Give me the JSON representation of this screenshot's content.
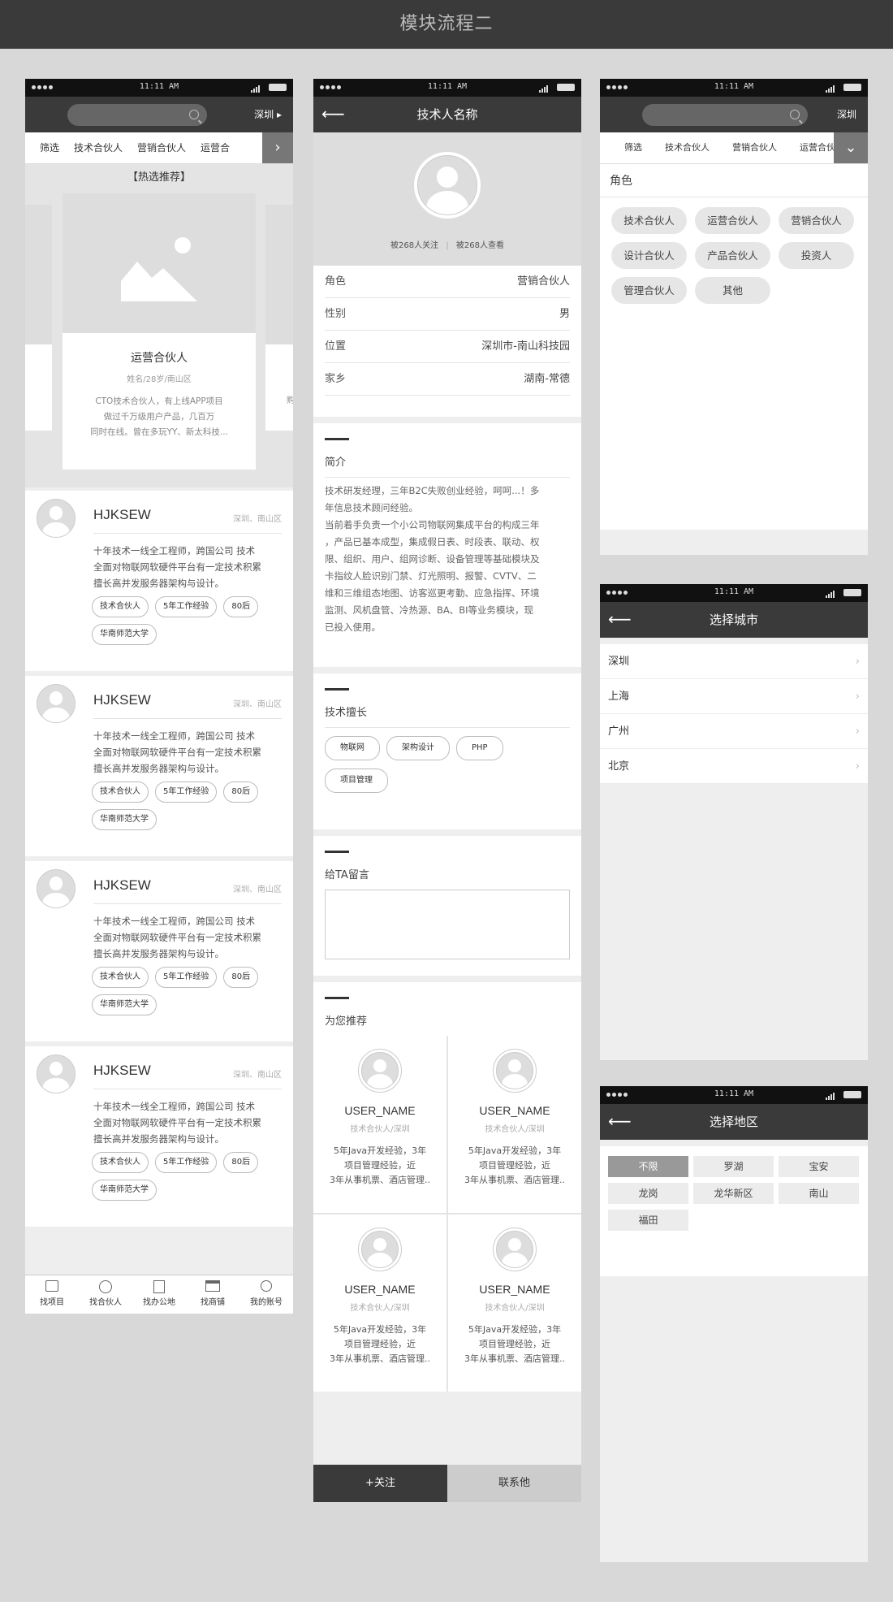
{
  "page_title": "模块流程二",
  "statusbar": {
    "time": "11:11 AM"
  },
  "screen1": {
    "city": "深圳",
    "tabs": [
      "筛选",
      "技术合伙人",
      "营销合伙人",
      "运营合"
    ],
    "hot_title": "【热选推荐】",
    "featured": {
      "role": "运营合伙人",
      "meta": "姓名/28岁/南山区",
      "desc1": "CTO技术合伙人，有上线APP项目",
      "desc2": "做过千万级用户产品，几百万",
      "desc3": "同时在线。曾在多玩YY、新太科技...",
      "side_text": "购"
    },
    "cards": [
      {
        "name": "HJKSEW",
        "loc": "深圳、南山区",
        "line1": "十年技术一线全工程师，跨国公司 技术",
        "line2": "全面对物联网软硬件平台有一定技术积累",
        "line3": "擅长高并发服务器架构与设计。",
        "tags": [
          "技术合伙人",
          "5年工作经验",
          "80后",
          "华南师范大学"
        ]
      },
      {
        "name": "HJKSEW",
        "loc": "深圳、南山区",
        "line1": "十年技术一线全工程师，跨国公司 技术",
        "line2": "全面对物联网软硬件平台有一定技术积累",
        "line3": "擅长高并发服务器架构与设计。",
        "tags": [
          "技术合伙人",
          "5年工作经验",
          "80后",
          "华南师范大学"
        ]
      },
      {
        "name": "HJKSEW",
        "loc": "深圳、南山区",
        "line1": "十年技术一线全工程师，跨国公司 技术",
        "line2": "全面对物联网软硬件平台有一定技术积累",
        "line3": "擅长高并发服务器架构与设计。",
        "tags": [
          "技术合伙人",
          "5年工作经验",
          "80后",
          "华南师范大学"
        ]
      },
      {
        "name": "HJKSEW",
        "loc": "深圳、南山区",
        "line1": "十年技术一线全工程师，跨国公司 技术",
        "line2": "全面对物联网软硬件平台有一定技术积累",
        "line3": "擅长高并发服务器架构与设计。",
        "tags": [
          "技术合伙人",
          "5年工作经验",
          "80后",
          "华南师范大学"
        ]
      }
    ],
    "nav": [
      "找项目",
      "找合伙人",
      "找办公地",
      "找商铺",
      "我的账号"
    ]
  },
  "screen2": {
    "title": "技术人名称",
    "follow_stat": "被268人关注",
    "view_stat": "被268人查看",
    "info": [
      {
        "k": "角色",
        "v": "营销合伙人"
      },
      {
        "k": "性别",
        "v": "男"
      },
      {
        "k": "位置",
        "v": "深圳市-南山科技园"
      },
      {
        "k": "家乡",
        "v": "湖南-常德"
      }
    ],
    "intro_title": "简介",
    "intro_lines": [
      "技术研发经理，三年B2C失败创业经验，呵呵...！多",
      "年信息技术顾问经验。",
      "当前着手负责一个小公司物联网集成平台的构成三年",
      "，产品已基本成型，集成假日表、时段表、联动、权",
      "限、组织、用户、组网诊断、设备管理等基础模块及",
      "卡指纹人脸识别门禁、灯光照明、报警、CVTV、二",
      "维和三维组态地图、访客巡更考勤、应急指挥、环境",
      "监测、风机盘管、冷热源、BA、BI等业务模块，现",
      "已投入使用。"
    ],
    "skills_title": "技术擅长",
    "skills": [
      "物联网",
      "架构设计",
      "PHP",
      "项目管理"
    ],
    "message_title": "给TA留言",
    "rec_title": "为您推荐",
    "recs": [
      {
        "name": "USER_NAME",
        "sub": "技术合伙人/深圳",
        "l1": "5年Java开发经验，3年",
        "l2": "项目管理经验，近",
        "l3": "3年从事机票、酒店管理.."
      },
      {
        "name": "USER_NAME",
        "sub": "技术合伙人/深圳",
        "l1": "5年Java开发经验，3年",
        "l2": "项目管理经验，近",
        "l3": "3年从事机票、酒店管理.."
      },
      {
        "name": "USER_NAME",
        "sub": "技术合伙人/深圳",
        "l1": "5年Java开发经验，3年",
        "l2": "项目管理经验，近",
        "l3": "3年从事机票、酒店管理.."
      },
      {
        "name": "USER_NAME",
        "sub": "技术合伙人/深圳",
        "l1": "5年Java开发经验，3年",
        "l2": "项目管理经验，近",
        "l3": "3年从事机票、酒店管理.."
      }
    ],
    "follow_btn": "+关注",
    "contact_btn": "联系他"
  },
  "screen3": {
    "city": "深圳",
    "tabs": [
      "筛选",
      "技术合伙人",
      "营销合伙人",
      "运营合伙"
    ],
    "role_title": "角色",
    "roles": [
      "技术合伙人",
      "运营合伙人",
      "营销合伙人",
      "设计合伙人",
      "产品合伙人",
      "投资人",
      "管理合伙人",
      "其他"
    ]
  },
  "screen4": {
    "title": "选择城市",
    "cities": [
      "深圳",
      "上海",
      "广州",
      "北京"
    ]
  },
  "screen5": {
    "title": "选择地区",
    "areas": [
      "不限",
      "罗湖",
      "宝安",
      "龙岗",
      "龙华新区",
      "南山",
      "福田"
    ]
  }
}
